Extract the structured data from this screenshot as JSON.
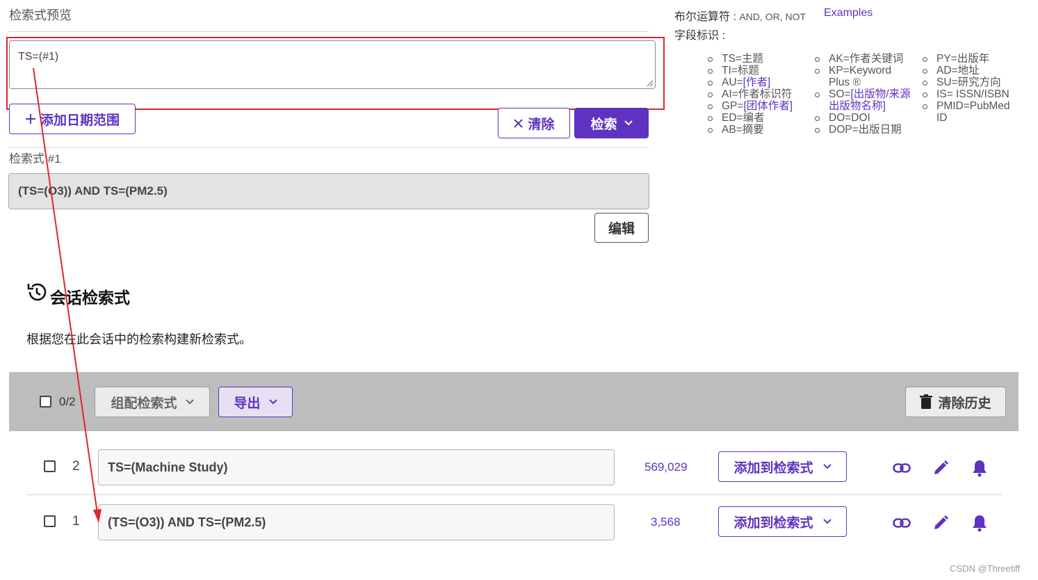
{
  "preview": {
    "title": "检索式预览",
    "query_value": "TS=(#1)",
    "add_date_range_label": "添加日期范围",
    "clear_label": "清除",
    "search_label": "检索"
  },
  "query1": {
    "label": "检索式 #1",
    "text": "(TS=(O3)) AND TS=(PM2.5)",
    "edit_label": "编辑"
  },
  "help": {
    "boolean_label": "布尔运算符 : ",
    "boolean_values": "AND, OR, NOT",
    "examples_label": "Examples",
    "field_tags_label": "字段标识 :",
    "col1": [
      {
        "text": "TS=主题"
      },
      {
        "text": "TI=标题"
      },
      {
        "prefix": "AU=",
        "link": "[作者]"
      },
      {
        "text": "AI=作者标识符"
      },
      {
        "prefix": "GP=",
        "link": "[团体作者]"
      },
      {
        "text": "ED=编者"
      },
      {
        "text": "AB=摘要"
      }
    ],
    "col2": [
      {
        "text": "AK=作者关键词"
      },
      {
        "text": "KP=Keyword Plus ®"
      },
      {
        "prefix": "SO=",
        "link": "[出版物/来源出版物名称]"
      },
      {
        "text": "DO=DOI"
      },
      {
        "text": "DOP=出版日期"
      }
    ],
    "col3": [
      {
        "text": "PY=出版年"
      },
      {
        "text": "AD=地址"
      },
      {
        "text": "SU=研究方向"
      },
      {
        "text": "IS= ISSN/ISBN"
      },
      {
        "text": "PMID=PubMed ID"
      }
    ]
  },
  "session": {
    "title": "会话检索式",
    "description": "根据您在此会话中的检索构建新检索式。",
    "selected_count": "0/2",
    "combine_label": "组配检索式",
    "export_label": "导出",
    "clear_history_label": "清除历史",
    "rows": [
      {
        "number": "2",
        "query": "TS=(Machine Study)",
        "count": "569,029",
        "add_label": "添加到检索式"
      },
      {
        "number": "1",
        "query": "(TS=(O3)) AND TS=(PM2.5)",
        "count": "3,568",
        "add_label": "添加到检索式"
      }
    ]
  },
  "icons": [
    "history-icon",
    "plus-icon",
    "close-icon",
    "chevron-down-icon",
    "trash-icon",
    "link-icon",
    "pencil-icon",
    "bell-icon"
  ],
  "colors": {
    "accent": "#5e33bf",
    "annotation_red": "#e0252b"
  },
  "watermark": "CSDN @Threetiff"
}
